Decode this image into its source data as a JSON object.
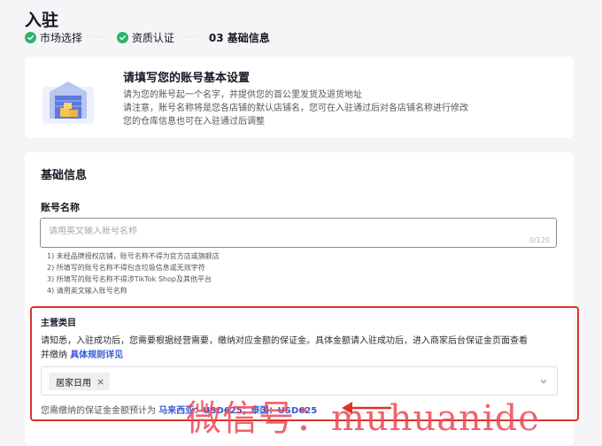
{
  "page": {
    "title": "入驻"
  },
  "steps": [
    {
      "label": "市场选择",
      "status": "done"
    },
    {
      "label": "资质认证",
      "status": "done"
    },
    {
      "label": "03 基础信息",
      "status": "current"
    }
  ],
  "intro": {
    "title": "请填写您的账号基本设置",
    "lines": [
      "请为您的账号起一个名字，并提供您的首公里发货及退货地址",
      "请注意，账号名称将是您各店铺的默认店铺名，您可在入驻通过后对各店铺名称进行修改",
      "您的仓库信息也可在入驻通过后调整"
    ]
  },
  "form": {
    "section_title": "基础信息",
    "account_name": {
      "label": "账号名称",
      "placeholder": "请用英文输入账号名称",
      "value": "",
      "counter": "0/120"
    },
    "rules": [
      "1) 未经品牌授权店铺，账号名称不得为官方店或旗舰店",
      "2) 所填写的账号名称不得包含垃圾信息或无效字符",
      "3) 所填写的账号名称不得涉TikTok Shop及其他平台",
      "4) 请用英文输入账号名称"
    ],
    "category": {
      "title": "主营类目",
      "desc_line1": "请知悉，入驻成功后，您需要根据经营需要，缴纳对应金额的保证金。具体金额请入驻成功后，进入商家后台保证金页面查看",
      "desc_line2_prefix": "并缴纳",
      "rules_link": "具体规则详见",
      "selected_tags": [
        "居家日用"
      ],
      "deposit_prefix": "您需缴纳的保证金金额预计为",
      "deposit_amounts": "马来西亚：USD625；泰国：USD625"
    }
  },
  "watermark": "微信号：muhuanide",
  "colors": {
    "accent": "#3457d5",
    "success": "#2fb36b",
    "highlight": "#d9342c"
  }
}
